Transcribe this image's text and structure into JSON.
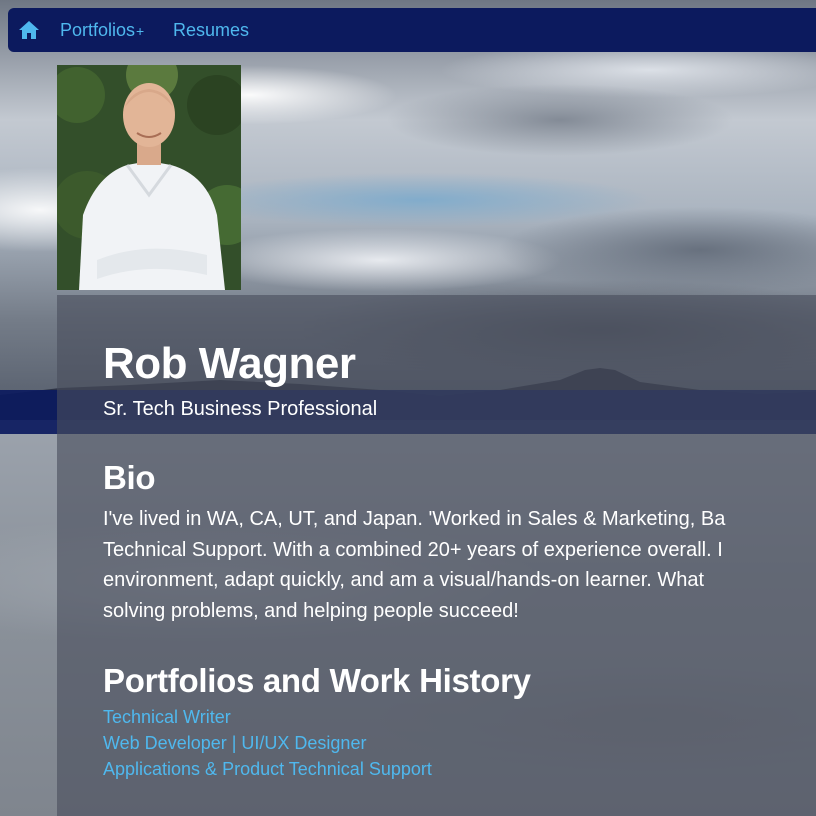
{
  "nav": {
    "home_icon": "home-icon",
    "items": [
      {
        "label": "Portfolios",
        "suffix": "+"
      },
      {
        "label": "Resumes"
      }
    ]
  },
  "profile": {
    "name": "Rob Wagner",
    "title": "Sr. Tech Business Professional"
  },
  "bio": {
    "heading": "Bio",
    "lines": [
      "I've lived in WA, CA, UT, and Japan. 'Worked in Sales & Marketing, Ba",
      "Technical Support. With a combined 20+ years of experience overall. I",
      "environment, adapt quickly, and am a visual/hands-on learner. What",
      "solving problems, and helping people succeed!"
    ]
  },
  "portfolios": {
    "heading": "Portfolios and Work History",
    "links": [
      "Technical Writer",
      "Web Developer | UI/UX Designer",
      "Applications & Product Technical Support"
    ]
  },
  "colors": {
    "navbar": "#0c1a5e",
    "link": "#4fb8ee",
    "text": "#ffffff"
  }
}
